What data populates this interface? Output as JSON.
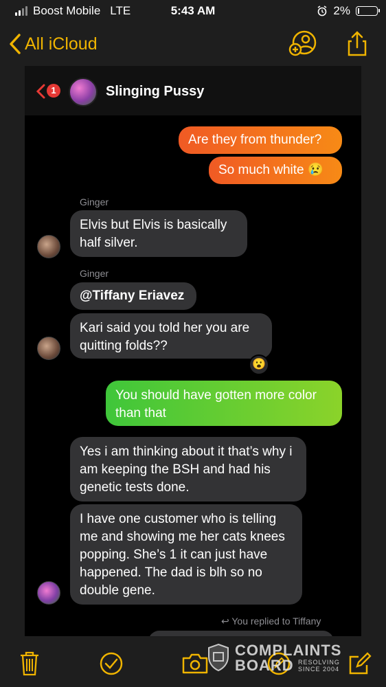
{
  "status_bar": {
    "carrier": "Boost Mobile",
    "network": "LTE",
    "time": "5:43 AM",
    "battery": "2%"
  },
  "nav": {
    "back_label": "All iCloud",
    "icons": [
      "add-person-icon",
      "share-icon"
    ],
    "accent": "#f0b400"
  },
  "chat": {
    "unread_badge": "1",
    "title": "Slinging Pussy"
  },
  "messages": [
    {
      "id": "m1",
      "direction": "outgoing",
      "color": "orange",
      "text": "Are they from thunder?"
    },
    {
      "id": "m2",
      "direction": "outgoing",
      "color": "orange",
      "text": "So much white 😢"
    },
    {
      "id": "m3",
      "direction": "incoming",
      "sender": "Ginger",
      "text": "Elvis but Elvis is basically half silver."
    },
    {
      "id": "m4",
      "direction": "incoming",
      "sender": "Ginger",
      "text": "@Tiffany Eriavez"
    },
    {
      "id": "m5",
      "direction": "incoming",
      "text": "Kari said you told her you are quitting folds??",
      "reaction": "😮"
    },
    {
      "id": "m6",
      "direction": "outgoing",
      "color": "green",
      "text": "You should have gotten more color than that"
    },
    {
      "id": "m7",
      "direction": "incoming",
      "text": "Yes i am thinking about it that’s why i am keeping the BSH and had his genetic tests done."
    },
    {
      "id": "m8",
      "direction": "incoming",
      "text": "I have one customer who is telling me and showing me her cats knees popping. She’s 1 it can just have happened. The dad is blh so no double gene."
    }
  ],
  "reply_note": "You replied to Tiffany",
  "toolbar": {
    "icons": [
      "trash-icon",
      "checkmark-icon",
      "camera-icon",
      "compose-icon"
    ]
  },
  "watermark": {
    "line1": "COMPLAINTS",
    "line2": "BOARD",
    "tag1": "RESOLVING",
    "tag2": "SINCE 2004"
  },
  "colors": {
    "background": "#1e1e1e",
    "incoming_bubble": "#333335",
    "outgoing_orange": "#f27322",
    "outgoing_green": "#5cc833",
    "badge": "#e53935"
  }
}
